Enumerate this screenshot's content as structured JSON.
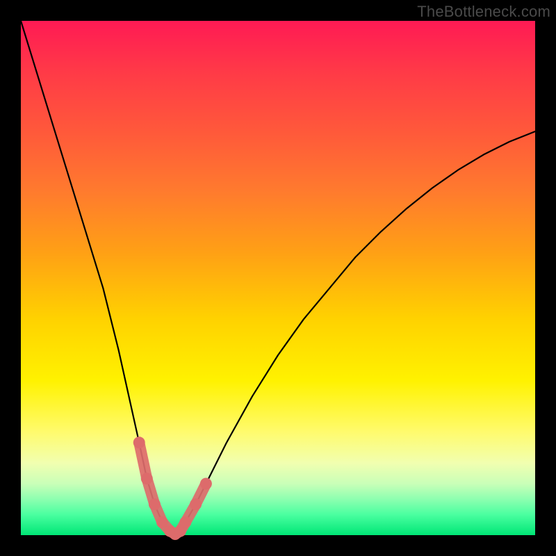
{
  "watermark": "TheBottleneck.com",
  "chart_data": {
    "type": "line",
    "title": "",
    "xlabel": "",
    "ylabel": "",
    "xlim": [
      0,
      100
    ],
    "ylim": [
      0,
      100
    ],
    "grid": false,
    "legend": false,
    "series": [
      {
        "name": "bottleneck-curve",
        "x": [
          0,
          4,
          8,
          12,
          16,
          19,
          21,
          23,
          24.5,
          26,
          27.5,
          29,
          30,
          31,
          32,
          34,
          36,
          40,
          45,
          50,
          55,
          60,
          65,
          70,
          75,
          80,
          85,
          90,
          95,
          100
        ],
        "values": [
          100,
          87,
          74,
          61,
          48,
          36,
          27,
          18,
          11,
          6,
          2.5,
          0.8,
          0.2,
          0.8,
          2.5,
          6,
          10,
          18,
          27,
          35,
          42,
          48,
          54,
          59,
          63.5,
          67.5,
          71,
          74,
          76.5,
          78.5
        ]
      }
    ],
    "highlight": {
      "name": "optimal-segment",
      "x_range": [
        22,
        36
      ],
      "color": "#dd6b6b"
    },
    "background_gradient": {
      "top": "#ff1a54",
      "mid": "#ffd200",
      "bottom": "#00e676"
    }
  }
}
